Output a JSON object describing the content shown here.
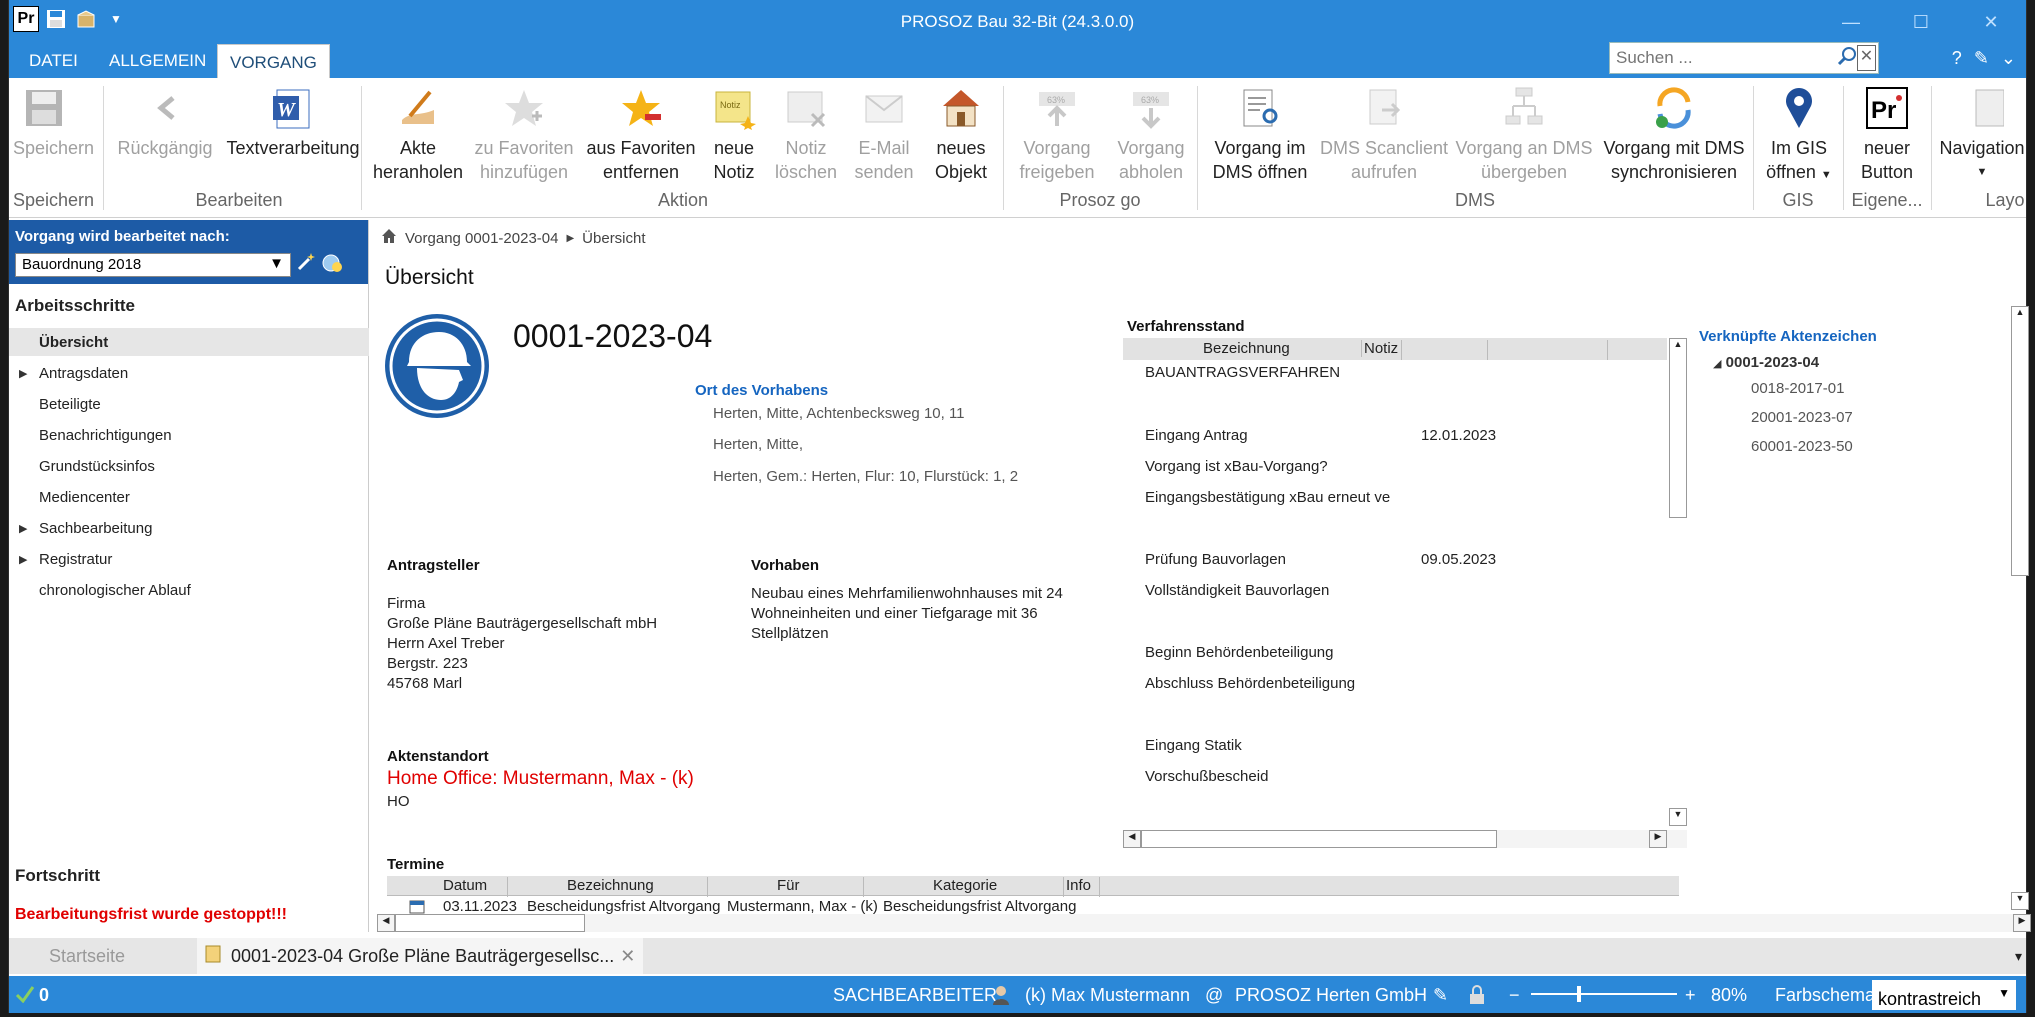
{
  "window": {
    "title": "PROSOZ Bau 32-Bit (24.3.0.0)"
  },
  "ribbon_tabs": [
    "DATEI",
    "ALLGEMEIN",
    "VORGANG"
  ],
  "search": {
    "placeholder": "Suchen ..."
  },
  "ribbon": {
    "speichern": "Speichern",
    "rueckgaengig": "Rückgängig",
    "textverarbeitung": "Textverarbeitung",
    "akte_1": "Akte",
    "akte_2": "heranholen",
    "zu_fav_1": "zu Favoriten",
    "zu_fav_2": "hinzufügen",
    "aus_fav_1": "aus Favoriten",
    "aus_fav_2": "entfernen",
    "neue_notiz_1": "neue",
    "neue_notiz_2": "Notiz",
    "notiz_loeschen_1": "Notiz",
    "notiz_loeschen_2": "löschen",
    "email_1": "E-Mail",
    "email_2": "senden",
    "neues_obj_1": "neues",
    "neues_obj_2": "Objekt",
    "v_freigeben_1": "Vorgang",
    "v_freigeben_2": "freigeben",
    "v_abholen_1": "Vorgang",
    "v_abholen_2": "abholen",
    "dms_oeffnen_1": "Vorgang im",
    "dms_oeffnen_2": "DMS öffnen",
    "dms_scan_1": "DMS Scanclient",
    "dms_scan_2": "aufrufen",
    "dms_uebergeben_1": "Vorgang an DMS",
    "dms_uebergeben_2": "übergeben",
    "dms_sync_1": "Vorgang mit DMS",
    "dms_sync_2": "synchronisieren",
    "gis_1": "Im GIS",
    "gis_2": "öffnen",
    "neuer_btn_1": "neuer",
    "neuer_btn_2": "Button",
    "navigation": "Navigation",
    "groups": {
      "speichern": "Speichern",
      "bearbeiten": "Bearbeiten",
      "aktion": "Aktion",
      "prosoz_go": "Prosoz go",
      "dms": "DMS",
      "gis": "GIS",
      "eigene": "Eigene...",
      "layout": "Layo"
    }
  },
  "left": {
    "header": "Vorgang wird bearbeitet nach:",
    "ordnung": "Bauordnung 2018",
    "section": "Arbeitsschritte",
    "items": [
      "Übersicht",
      "Antragsdaten",
      "Beteiligte",
      "Benachrichtigungen",
      "Grundstücksinfos",
      "Mediencenter",
      "Sachbearbeitung",
      "Registratur",
      "chronologischer Ablauf"
    ],
    "progress_title": "Fortschritt",
    "progress_warning": "Bearbeitungsfrist wurde gestoppt!!!"
  },
  "breadcrumb": {
    "part1": "Vorgang 0001-2023-04",
    "part2": "Übersicht"
  },
  "overview": {
    "title": "Übersicht",
    "case_id": "0001-2023-04",
    "ort_label": "Ort des Vorhabens",
    "ort_lines": [
      "Herten, Mitte, Achtenbecksweg 10, 11",
      "Herten, Mitte,",
      "Herten, Gem.: Herten, Flur: 10, Flurstück: 1, 2"
    ],
    "antragsteller_label": "Antragsteller",
    "antragsteller": [
      "Firma",
      "Große Pläne Bauträgergesellschaft mbH",
      "Herrn Axel Treber",
      "Bergstr. 223",
      "45768 Marl"
    ],
    "vorhaben_label": "Vorhaben",
    "vorhaben": [
      "Neubau eines Mehrfamilienwohnhauses mit 24",
      "Wohneinheiten und einer Tiefgarage mit 36",
      "Stellplätzen"
    ],
    "aktenstandort_label": "Aktenstandort",
    "aktenstandort": "Home Office: Mustermann, Max - (k)",
    "aktenstandort_code": "HO"
  },
  "verfahrensstand": {
    "title": "Verfahrensstand",
    "col_bezeichnung": "Bezeichnung",
    "col_notiz": "Notiz",
    "rows": [
      {
        "label": "BAUANTRAGSVERFAHREN",
        "date": ""
      },
      {
        "label": "Eingang Antrag",
        "date": "12.01.2023"
      },
      {
        "label": "Vorgang ist xBau-Vorgang?",
        "date": ""
      },
      {
        "label": "Eingangsbestätigung xBau erneut ve",
        "date": ""
      },
      {
        "label": "Prüfung  Bauvorlagen",
        "date": "09.05.2023"
      },
      {
        "label": "Vollständigkeit Bauvorlagen",
        "date": ""
      },
      {
        "label": "Beginn Behördenbeteiligung",
        "date": ""
      },
      {
        "label": "Abschluss Behördenbeteiligung",
        "date": ""
      },
      {
        "label": "Eingang Statik",
        "date": ""
      },
      {
        "label": "Vorschußbescheid",
        "date": ""
      }
    ]
  },
  "linked": {
    "title": "Verknüpfte Aktenzeichen",
    "root": "0001-2023-04",
    "children": [
      "0018-2017-01",
      "20001-2023-07",
      "60001-2023-50"
    ]
  },
  "termine": {
    "title": "Termine",
    "columns": [
      "Datum",
      "Bezeichnung",
      "Für",
      "Kategorie",
      "Info"
    ],
    "row": [
      "03.11.2023",
      "Bescheidungsfrist Altvorgang",
      "Mustermann, Max - (k)",
      "Bescheidungsfrist Altvorgang",
      ""
    ]
  },
  "doctabs": {
    "start": "Startseite",
    "current": "0001-2023-04 Große Pläne Bauträgergesellsc..."
  },
  "status": {
    "count": "0",
    "sachbearbeiter_label": "SACHBEARBEITER:",
    "user": "(k) Max Mustermann",
    "at": "@",
    "org": "PROSOZ Herten GmbH",
    "zoom": "80%",
    "farbschema_label": "Farbschema",
    "farbschema_value": "kontrastreich"
  },
  "colors": {
    "accent": "#2b88d8",
    "header_blue": "#1d5ba6",
    "link_blue": "#1565c0",
    "warning_red": "#e00000"
  }
}
